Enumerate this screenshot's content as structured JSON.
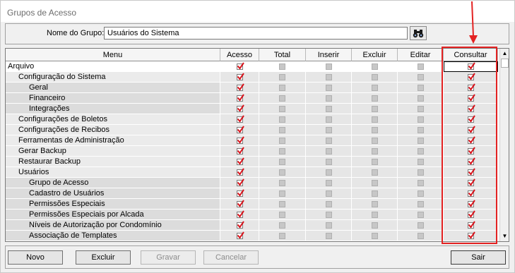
{
  "window": {
    "title": "Grupos de Acesso"
  },
  "group": {
    "label": "Nome do Grupo:",
    "value": "Usuários do Sistema"
  },
  "grid": {
    "columns": [
      "Menu",
      "Acesso",
      "Total",
      "Inserir",
      "Excluir",
      "Editar",
      "Consultar"
    ],
    "rows": [
      {
        "label": "Arquivo",
        "level": 0,
        "checks": [
          true,
          false,
          false,
          false,
          false,
          true
        ]
      },
      {
        "label": "Configuração do Sistema",
        "level": 1,
        "checks": [
          true,
          false,
          false,
          false,
          false,
          true
        ]
      },
      {
        "label": "Geral",
        "level": 2,
        "checks": [
          true,
          false,
          false,
          false,
          false,
          true
        ]
      },
      {
        "label": "Financeiro",
        "level": 2,
        "checks": [
          true,
          false,
          false,
          false,
          false,
          true
        ]
      },
      {
        "label": "Integrações",
        "level": 2,
        "checks": [
          true,
          false,
          false,
          false,
          false,
          true
        ]
      },
      {
        "label": "Configurações de Boletos",
        "level": 1,
        "checks": [
          true,
          false,
          false,
          false,
          false,
          true
        ]
      },
      {
        "label": "Configurações de Recibos",
        "level": 1,
        "checks": [
          true,
          false,
          false,
          false,
          false,
          true
        ]
      },
      {
        "label": "Ferramentas de Administração",
        "level": 1,
        "checks": [
          true,
          false,
          false,
          false,
          false,
          true
        ]
      },
      {
        "label": "Gerar Backup",
        "level": 1,
        "checks": [
          true,
          false,
          false,
          false,
          false,
          true
        ]
      },
      {
        "label": "Restaurar Backup",
        "level": 1,
        "checks": [
          true,
          false,
          false,
          false,
          false,
          true
        ]
      },
      {
        "label": "Usuários",
        "level": 1,
        "checks": [
          true,
          false,
          false,
          false,
          false,
          true
        ]
      },
      {
        "label": "Grupo de Acesso",
        "level": 2,
        "checks": [
          true,
          false,
          false,
          false,
          false,
          true
        ]
      },
      {
        "label": "Cadastro de Usuários",
        "level": 2,
        "checks": [
          true,
          false,
          false,
          false,
          false,
          true
        ]
      },
      {
        "label": "Permissões Especiais",
        "level": 2,
        "checks": [
          true,
          false,
          false,
          false,
          false,
          true
        ]
      },
      {
        "label": "Permissões Especiais por Alcada",
        "level": 2,
        "checks": [
          true,
          false,
          false,
          false,
          false,
          true
        ]
      },
      {
        "label": "Níveis de Autorização por Condomínio",
        "level": 2,
        "checks": [
          true,
          false,
          false,
          false,
          false,
          true
        ]
      },
      {
        "label": "Associação de Templates",
        "level": 2,
        "checks": [
          true,
          false,
          false,
          false,
          false,
          true
        ]
      }
    ]
  },
  "buttons": {
    "novo": "Novo",
    "excluir": "Excluir",
    "gravar": "Gravar",
    "cancelar": "Cancelar",
    "sair": "Sair"
  },
  "colors": {
    "highlight": "#e32222",
    "check": "#d8141c"
  }
}
